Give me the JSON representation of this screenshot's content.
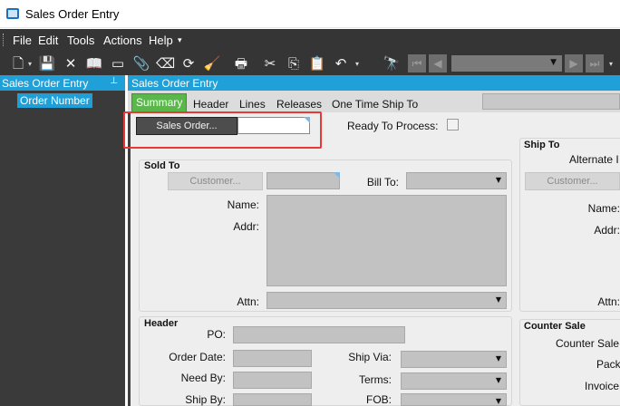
{
  "window": {
    "title": "Sales Order Entry"
  },
  "menu": [
    "File",
    "Edit",
    "Tools",
    "Actions",
    "Help"
  ],
  "toolbar": {
    "icons": [
      "new-icon",
      "save-icon",
      "delete-icon",
      "book-icon",
      "note-icon",
      "attach-icon",
      "eraser-icon",
      "refresh-icon",
      "clear-icon",
      "print-icon",
      "cut-icon",
      "copy-icon",
      "paste-icon",
      "undo-icon",
      "binoculars-icon",
      "first-record-icon",
      "previous-record-icon",
      "next-record-icon",
      "last-record-icon"
    ],
    "glyphs": {
      "new": "🗋",
      "save": "💾",
      "delete": "✕",
      "book": "📖",
      "note": "▭",
      "attach": "📎",
      "eraser": "⌫",
      "refresh": "⟳",
      "clear": "🧹",
      "print": "🖶",
      "cut": "✂",
      "copy": "⎘",
      "paste": "📋",
      "undo": "↶",
      "search": "🔭",
      "first": "⏮",
      "prev": "◀",
      "next": "▶",
      "last": "⏭",
      "dropdown": "▾"
    }
  },
  "tree_panel": {
    "title": "Sales Order Entry",
    "pin": "⊥",
    "node": "Order Number"
  },
  "main_panel": {
    "title": "Sales Order Entry",
    "tabs": [
      "Summary",
      "Header",
      "Lines",
      "Releases",
      "One Time Ship To"
    ]
  },
  "summary": {
    "sales_order_button": "Sales Order...",
    "sales_order_value": "",
    "ready_to_process_label": "Ready To Process:",
    "sold_to": {
      "title": "Sold To",
      "customer_button": "Customer...",
      "bill_to_label": "Bill To:",
      "name_label": "Name:",
      "addr_label": "Addr:",
      "attn_label": "Attn:"
    },
    "ship_to": {
      "title": "Ship To",
      "alternate_label": "Alternate I",
      "customer_button": "Customer...",
      "name_label": "Name:",
      "addr_label": "Addr:",
      "attn_label": "Attn:"
    },
    "header": {
      "title": "Header",
      "po_label": "PO:",
      "order_date_label": "Order Date:",
      "need_by_label": "Need By:",
      "ship_by_label": "Ship By:",
      "ship_via_label": "Ship Via:",
      "terms_label": "Terms:",
      "fob_label": "FOB:"
    },
    "counter_sale": {
      "title": "Counter Sale",
      "counter_sale_label": "Counter Sale",
      "pack_label": "Pack",
      "invoice_label": "Invoice"
    }
  },
  "caret": "▼"
}
